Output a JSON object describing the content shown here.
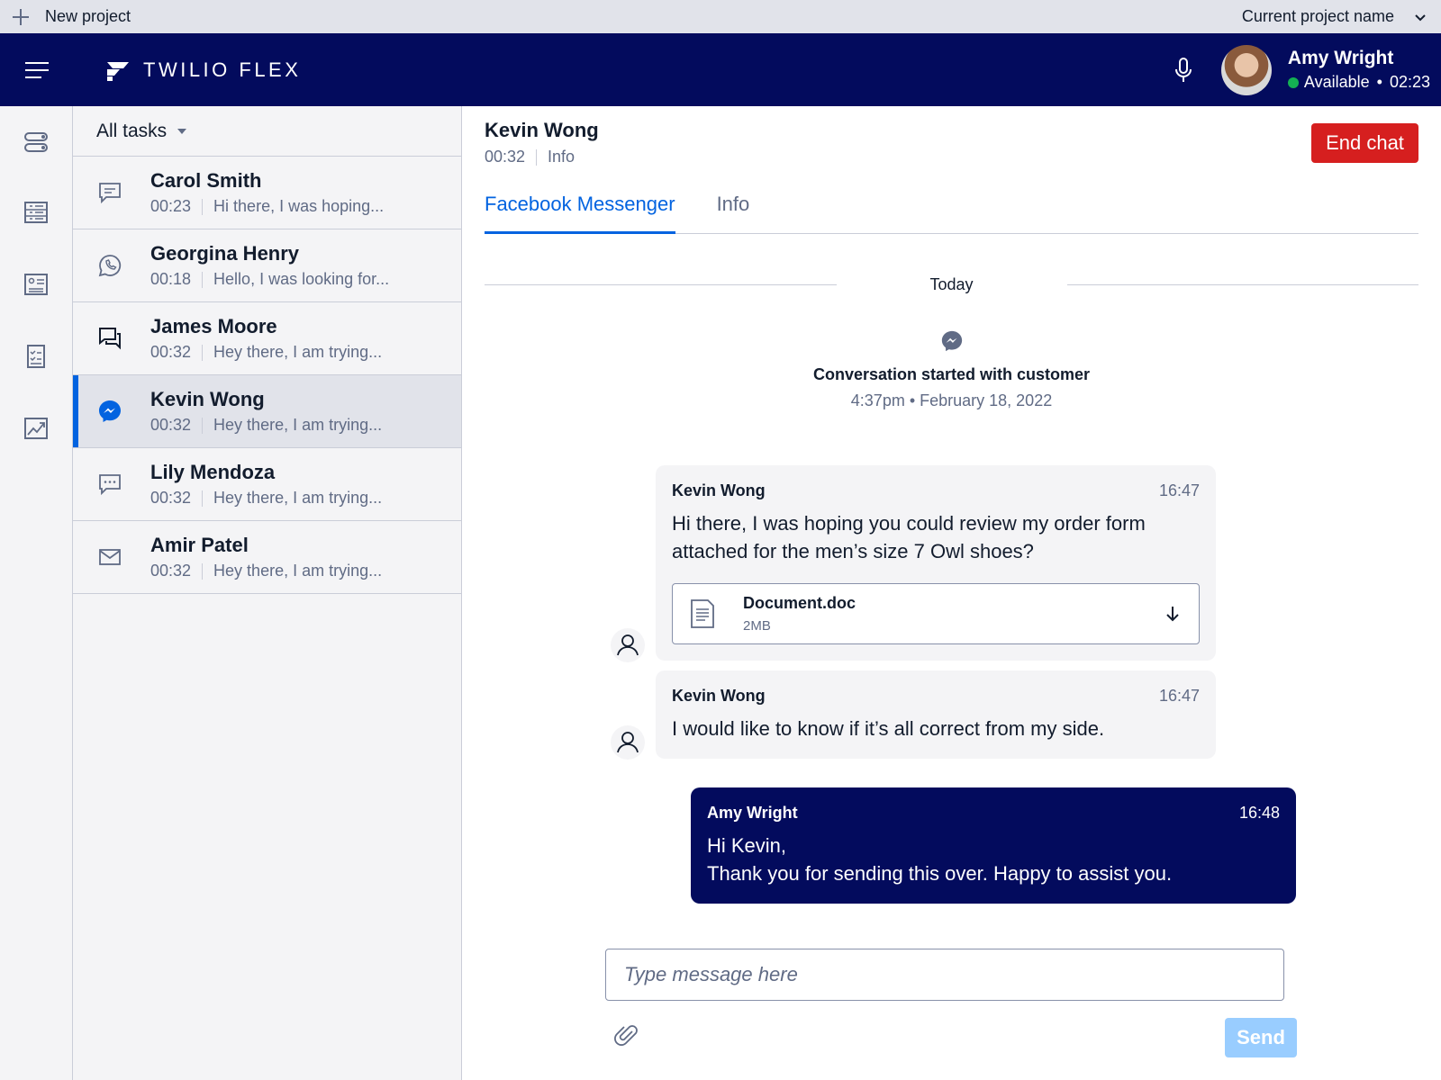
{
  "project_bar": {
    "new_project_label": "New project",
    "current_project_label": "Current project name"
  },
  "header": {
    "brand": "TWILIO FLEX",
    "user_name": "Amy Wright",
    "status": "Available",
    "status_separator": "•",
    "timer": "02:23",
    "status_color": "#14b053",
    "header_color": "#030b5d"
  },
  "left_nav": {
    "icons": [
      "toggle-icon",
      "queue-list-icon",
      "contact-card-icon",
      "checklist-icon",
      "analytics-chart-icon"
    ]
  },
  "task_list": {
    "filter_label": "All tasks",
    "tasks": [
      {
        "name": "Carol Smith",
        "time": "00:23",
        "preview": "Hi there, I was hoping...",
        "channel_icon": "chat-icon",
        "selected": false
      },
      {
        "name": "Georgina Henry",
        "time": "00:18",
        "preview": "Hello, I was looking for...",
        "channel_icon": "whatsapp-icon",
        "selected": false
      },
      {
        "name": "James Moore",
        "time": "00:32",
        "preview": "Hey there, I am trying...",
        "channel_icon": "conversations-icon",
        "selected": false
      },
      {
        "name": "Kevin Wong",
        "time": "00:32",
        "preview": "Hey there, I am trying...",
        "channel_icon": "messenger-icon",
        "selected": true
      },
      {
        "name": "Lily Mendoza",
        "time": "00:32",
        "preview": "Hey there, I am trying...",
        "channel_icon": "sms-icon",
        "selected": false
      },
      {
        "name": "Amir Patel",
        "time": "00:32",
        "preview": "Hey there, I am trying...",
        "channel_icon": "email-icon",
        "selected": false
      }
    ]
  },
  "conversation": {
    "customer_name": "Kevin Wong",
    "elapsed": "00:32",
    "info_link": "Info",
    "end_chat_label": "End chat",
    "end_chat_color": "#d61f1f",
    "tabs": [
      {
        "label": "Facebook Messenger",
        "active": true
      },
      {
        "label": "Info",
        "active": false
      }
    ],
    "day_divider": "Today",
    "started_text": "Conversation started with customer",
    "started_date": "4:37pm • February 18, 2022",
    "messages": [
      {
        "author": "Kevin Wong",
        "time": "16:47",
        "text": "Hi there, I was hoping you could review my order form attached for the men’s size 7 Owl shoes?",
        "attachment": {
          "name": "Document.doc",
          "size": "2MB"
        }
      },
      {
        "author": "Kevin Wong",
        "time": "16:47",
        "text": "I would like to know if it’s all correct from my side."
      },
      {
        "author": "Amy Wright",
        "time": "16:48",
        "line1": "Hi Kevin,",
        "line2": "Thank you for sending this over. Happy to assist you."
      }
    ],
    "composer_placeholder": "Type message here",
    "send_label": "Send"
  }
}
